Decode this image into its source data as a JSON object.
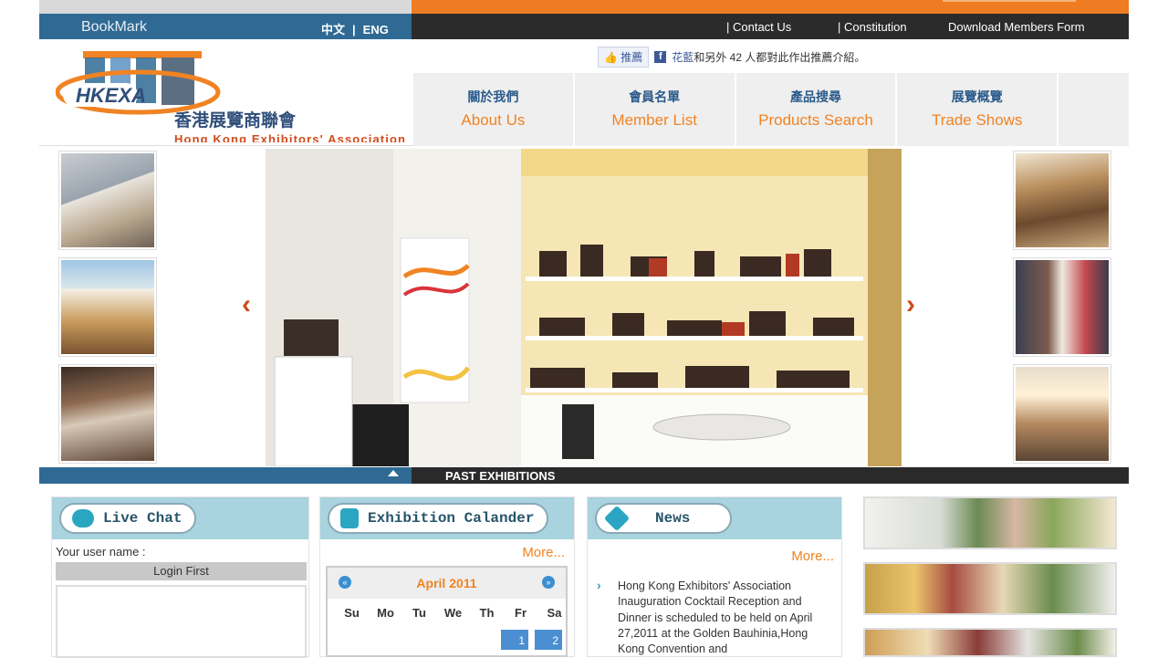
{
  "topbar": {
    "bookmark": "BookMark",
    "lang_zh": "中文",
    "lang_sep": "|",
    "lang_en": "ENG",
    "links": [
      {
        "label": "| Contact Us"
      },
      {
        "label": "| Constitution"
      },
      {
        "label": "Download Members Form"
      }
    ]
  },
  "logo": {
    "abbr": "HKEXA",
    "name_zh": "香港展覽商聯會",
    "name_en": "Hong Kong Exhibitors' Association"
  },
  "facebook": {
    "like_label": "推薦",
    "friend_name": "花藍",
    "text": "和另外 42 人都對此作出推薦介紹。"
  },
  "nav": [
    {
      "zh": "關於我們",
      "en": "About Us"
    },
    {
      "zh": "會員名單",
      "en": "Member List"
    },
    {
      "zh": "產品搜尋",
      "en": "Products Search"
    },
    {
      "zh": "展覽概覽",
      "en": "Trade Shows"
    },
    {
      "zh": "",
      "en": ""
    }
  ],
  "past_exhibitions": "PAST EXHIBITIONS",
  "live_chat": {
    "title": "Live Chat",
    "user_label": "Your user name :",
    "login_label": "Login First"
  },
  "calendar": {
    "title": "Exhibition Calander",
    "more": "More...",
    "month": "April 2011",
    "prev": "«",
    "next": "»",
    "dows": [
      "Su",
      "Mo",
      "Tu",
      "We",
      "Th",
      "Fr",
      "Sa"
    ],
    "days": [
      "1",
      "2"
    ]
  },
  "news": {
    "title": "News",
    "more": "More...",
    "item": "Hong Kong Exhibitors' Association Inauguration Cocktail Reception and Dinner is scheduled to be held on April 27,2011 at the Golden Bauhinia,Hong Kong Convention and"
  },
  "colors": {
    "orange": "#ef7b22",
    "blue": "#2f6a94",
    "dark": "#2b2b2b",
    "panel_head": "#a9d3df"
  }
}
